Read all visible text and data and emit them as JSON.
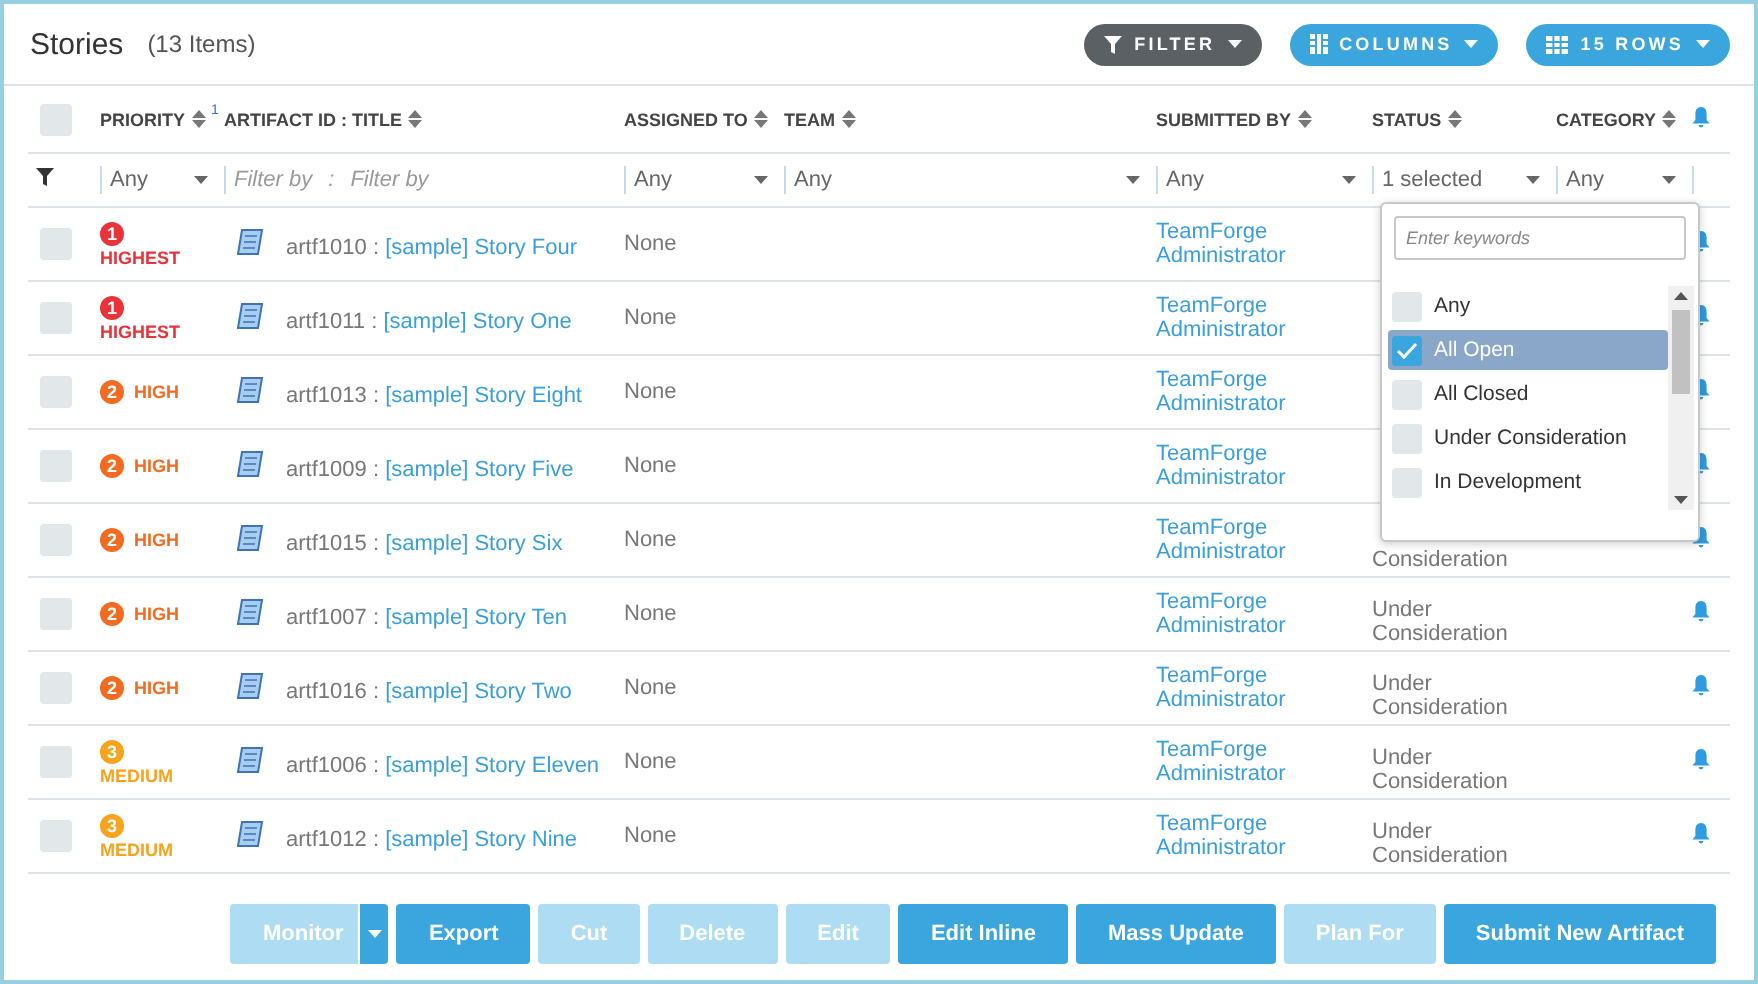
{
  "header": {
    "title": "Stories",
    "count": "(13 Items)"
  },
  "toolbar": [
    {
      "kind": "filter",
      "label": "FILTER"
    },
    {
      "kind": "columns",
      "label": "COLUMNS"
    },
    {
      "kind": "rows",
      "label": "15 ROWS"
    }
  ],
  "select_all": {
    "checked": false
  },
  "columns": [
    {
      "label": "PRIORITY",
      "sort_index": "1"
    },
    {
      "label": "ARTIFACT ID : TITLE"
    },
    {
      "label": "ASSIGNED TO"
    },
    {
      "label": "TEAM"
    },
    {
      "label": "SUBMITTED BY"
    },
    {
      "label": "STATUS"
    },
    {
      "label": "CATEGORY"
    }
  ],
  "filters": [
    {
      "kind": "select",
      "value": "Any"
    },
    {
      "kind": "text_pair",
      "placeholder": "Filter by",
      "separator": ":",
      "placeholder_2": "Filter by"
    },
    {
      "kind": "select",
      "value": "Any"
    },
    {
      "kind": "select",
      "value": "Any"
    },
    {
      "kind": "select",
      "value": "Any"
    },
    {
      "kind": "select",
      "value": "1 selected"
    },
    {
      "kind": "select",
      "value": "Any"
    }
  ],
  "rows": [
    {
      "checked": false,
      "priority": {
        "number": "1",
        "label": "HIGHEST",
        "color": "#e8333a",
        "kind": "stacked"
      },
      "id": "artf1010",
      "separator": ":",
      "title": "[sample] Story Four",
      "assigned": "None",
      "submitted_by": "TeamForge Administrator"
    },
    {
      "checked": false,
      "priority": {
        "number": "1",
        "label": "HIGHEST",
        "color": "#e8333a",
        "kind": "stacked"
      },
      "id": "artf1011",
      "separator": ":",
      "title": "[sample] Story One",
      "assigned": "None",
      "submitted_by": "TeamForge Administrator"
    },
    {
      "checked": false,
      "priority": {
        "number": "2",
        "label": "HIGH",
        "color": "#f26b21",
        "kind": "inline"
      },
      "id": "artf1013",
      "separator": ":",
      "title": "[sample] Story Eight",
      "assigned": "None",
      "submitted_by": "TeamForge Administrator"
    },
    {
      "checked": false,
      "priority": {
        "number": "2",
        "label": "HIGH",
        "color": "#f26b21",
        "kind": "inline"
      },
      "id": "artf1009",
      "separator": ":",
      "title": "[sample] Story Five",
      "assigned": "None",
      "submitted_by": "TeamForge Administrator"
    },
    {
      "checked": false,
      "priority": {
        "number": "2",
        "label": "HIGH",
        "color": "#f26b21",
        "kind": "inline"
      },
      "id": "artf1015",
      "separator": ":",
      "title": "[sample] Story Six",
      "assigned": "None",
      "submitted_by": "TeamForge Administrator",
      "status": "Consideration"
    },
    {
      "checked": false,
      "priority": {
        "number": "2",
        "label": "HIGH",
        "color": "#f26b21",
        "kind": "inline"
      },
      "id": "artf1007",
      "separator": ":",
      "title": "[sample] Story Ten",
      "assigned": "None",
      "submitted_by": "TeamForge Administrator",
      "status": "Under Consideration"
    },
    {
      "checked": false,
      "priority": {
        "number": "2",
        "label": "HIGH",
        "color": "#f26b21",
        "kind": "inline"
      },
      "id": "artf1016",
      "separator": ":",
      "title": "[sample] Story Two",
      "assigned": "None",
      "submitted_by": "TeamForge Administrator",
      "status": "Under Consideration"
    },
    {
      "checked": false,
      "priority": {
        "number": "3",
        "label": "MEDIUM",
        "color": "#f9a21b",
        "kind": "stacked"
      },
      "id": "artf1006",
      "separator": ":",
      "title": "[sample] Story Eleven",
      "assigned": "None",
      "submitted_by": "TeamForge Administrator",
      "status": "Under Consideration"
    },
    {
      "checked": false,
      "priority": {
        "number": "3",
        "label": "MEDIUM",
        "color": "#f9a21b",
        "kind": "stacked"
      },
      "id": "artf1012",
      "separator": ":",
      "title": "[sample] Story Nine",
      "assigned": "None",
      "submitted_by": "TeamForge Administrator",
      "status": "Under Consideration"
    }
  ],
  "status_dropdown": {
    "placeholder": "Enter keywords",
    "options": [
      {
        "label": "Any",
        "checked": false,
        "selected": false
      },
      {
        "label": "All Open",
        "checked": true,
        "selected": true
      },
      {
        "label": "All Closed",
        "checked": false,
        "selected": false
      },
      {
        "label": "Under Consideration",
        "checked": false,
        "selected": false
      },
      {
        "label": "In Development",
        "checked": false,
        "selected": false
      }
    ]
  },
  "actions": [
    {
      "label": "Monitor",
      "disabled": true,
      "split": true
    },
    {
      "label": "Export",
      "disabled": false
    },
    {
      "label": "Cut",
      "disabled": true
    },
    {
      "label": "Delete",
      "disabled": true
    },
    {
      "label": "Edit",
      "disabled": true
    },
    {
      "label": "Edit Inline",
      "disabled": false
    },
    {
      "label": "Mass Update",
      "disabled": false
    },
    {
      "label": "Plan For",
      "disabled": true
    },
    {
      "label": "Submit New Artifact",
      "disabled": false
    }
  ]
}
